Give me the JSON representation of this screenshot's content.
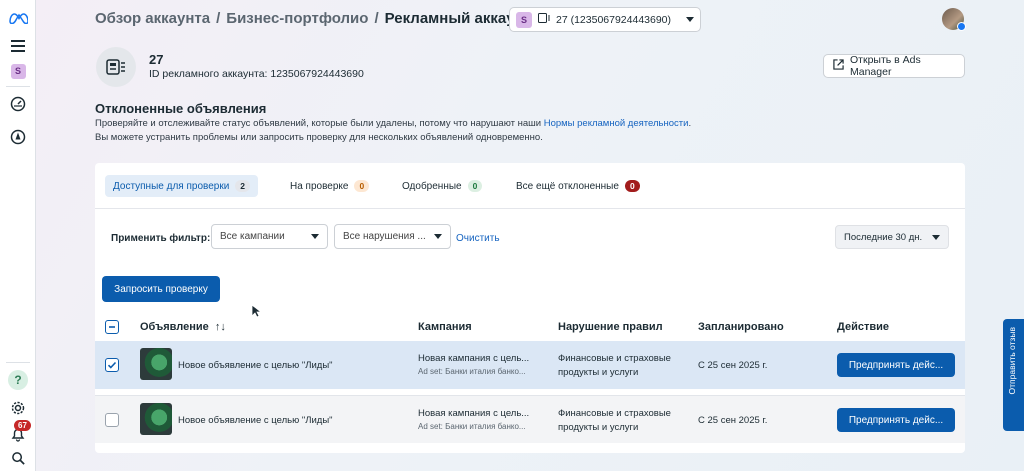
{
  "breadcrumb": {
    "item1": "Обзор аккаунта",
    "sep1": "/",
    "item2": "Бизнес-портфолио",
    "sep2": "/",
    "current": "Рекламный аккаунт"
  },
  "account_selector": {
    "badge": "S",
    "value": "27 (1235067924443690)"
  },
  "rail": {
    "badge": "S",
    "notifications_count": "67"
  },
  "account": {
    "name": "27",
    "id_label": "ID рекламного аккаунта: 1235067924443690"
  },
  "open_button": "Открыть в Ads Manager",
  "section": {
    "title": "Отклоненные объявления",
    "desc_part1": "Проверяйте и отслеживайте статус объявлений, которые были удалены, потому что нарушают наши ",
    "desc_link": "Нормы рекламной деятельности",
    "desc_part2": ".",
    "desc_line2": "Вы можете устранить проблемы или запросить проверку для нескольких объявлений одновременно."
  },
  "tabs": [
    {
      "label": "Доступные для проверки",
      "count": "2"
    },
    {
      "label": "На проверке",
      "count": "0"
    },
    {
      "label": "Одобренные",
      "count": "0"
    },
    {
      "label": "Все ещё отклоненные",
      "count": "0"
    }
  ],
  "filters": {
    "label": "Применить фильтр:",
    "campaigns": "Все кампании",
    "violations": "Все нарушения ...",
    "clear": "Очистить",
    "date": "Последние 30 дн."
  },
  "request_button": "Запросить проверку",
  "table": {
    "headers": {
      "ad": "Объявление",
      "sort": "↑↓",
      "campaign": "Кампания",
      "violation": "Нарушение правил",
      "scheduled": "Запланировано",
      "action": "Действие"
    },
    "rows": [
      {
        "ad": "Новое объявление с целью \"Лиды\"",
        "campaign": "Новая кампания с цель...",
        "adset": "Ad set: Банки италия банко...",
        "violation_line1": "Финансовые и страховые",
        "violation_line2": "продукты и услуги",
        "scheduled": "С 25 сен 2025 г.",
        "action": "Предпринять дейс...",
        "checked": true
      },
      {
        "ad": "Новое объявление с целью \"Лиды\"",
        "campaign": "Новая кампания с цель...",
        "adset": "Ad set: Банки италия банко...",
        "violation_line1": "Финансовые и страховые",
        "violation_line2": "продукты и услуги",
        "scheduled": "С 25 сен 2025 г.",
        "action": "Предпринять дейс...",
        "checked": false
      }
    ]
  },
  "feedback_tab": "Отправить отзыв",
  "colors": {
    "primary": "#0b5cad",
    "link": "#1664c0",
    "danger": "#a21c1c",
    "selected_row": "#dbe7f5"
  }
}
